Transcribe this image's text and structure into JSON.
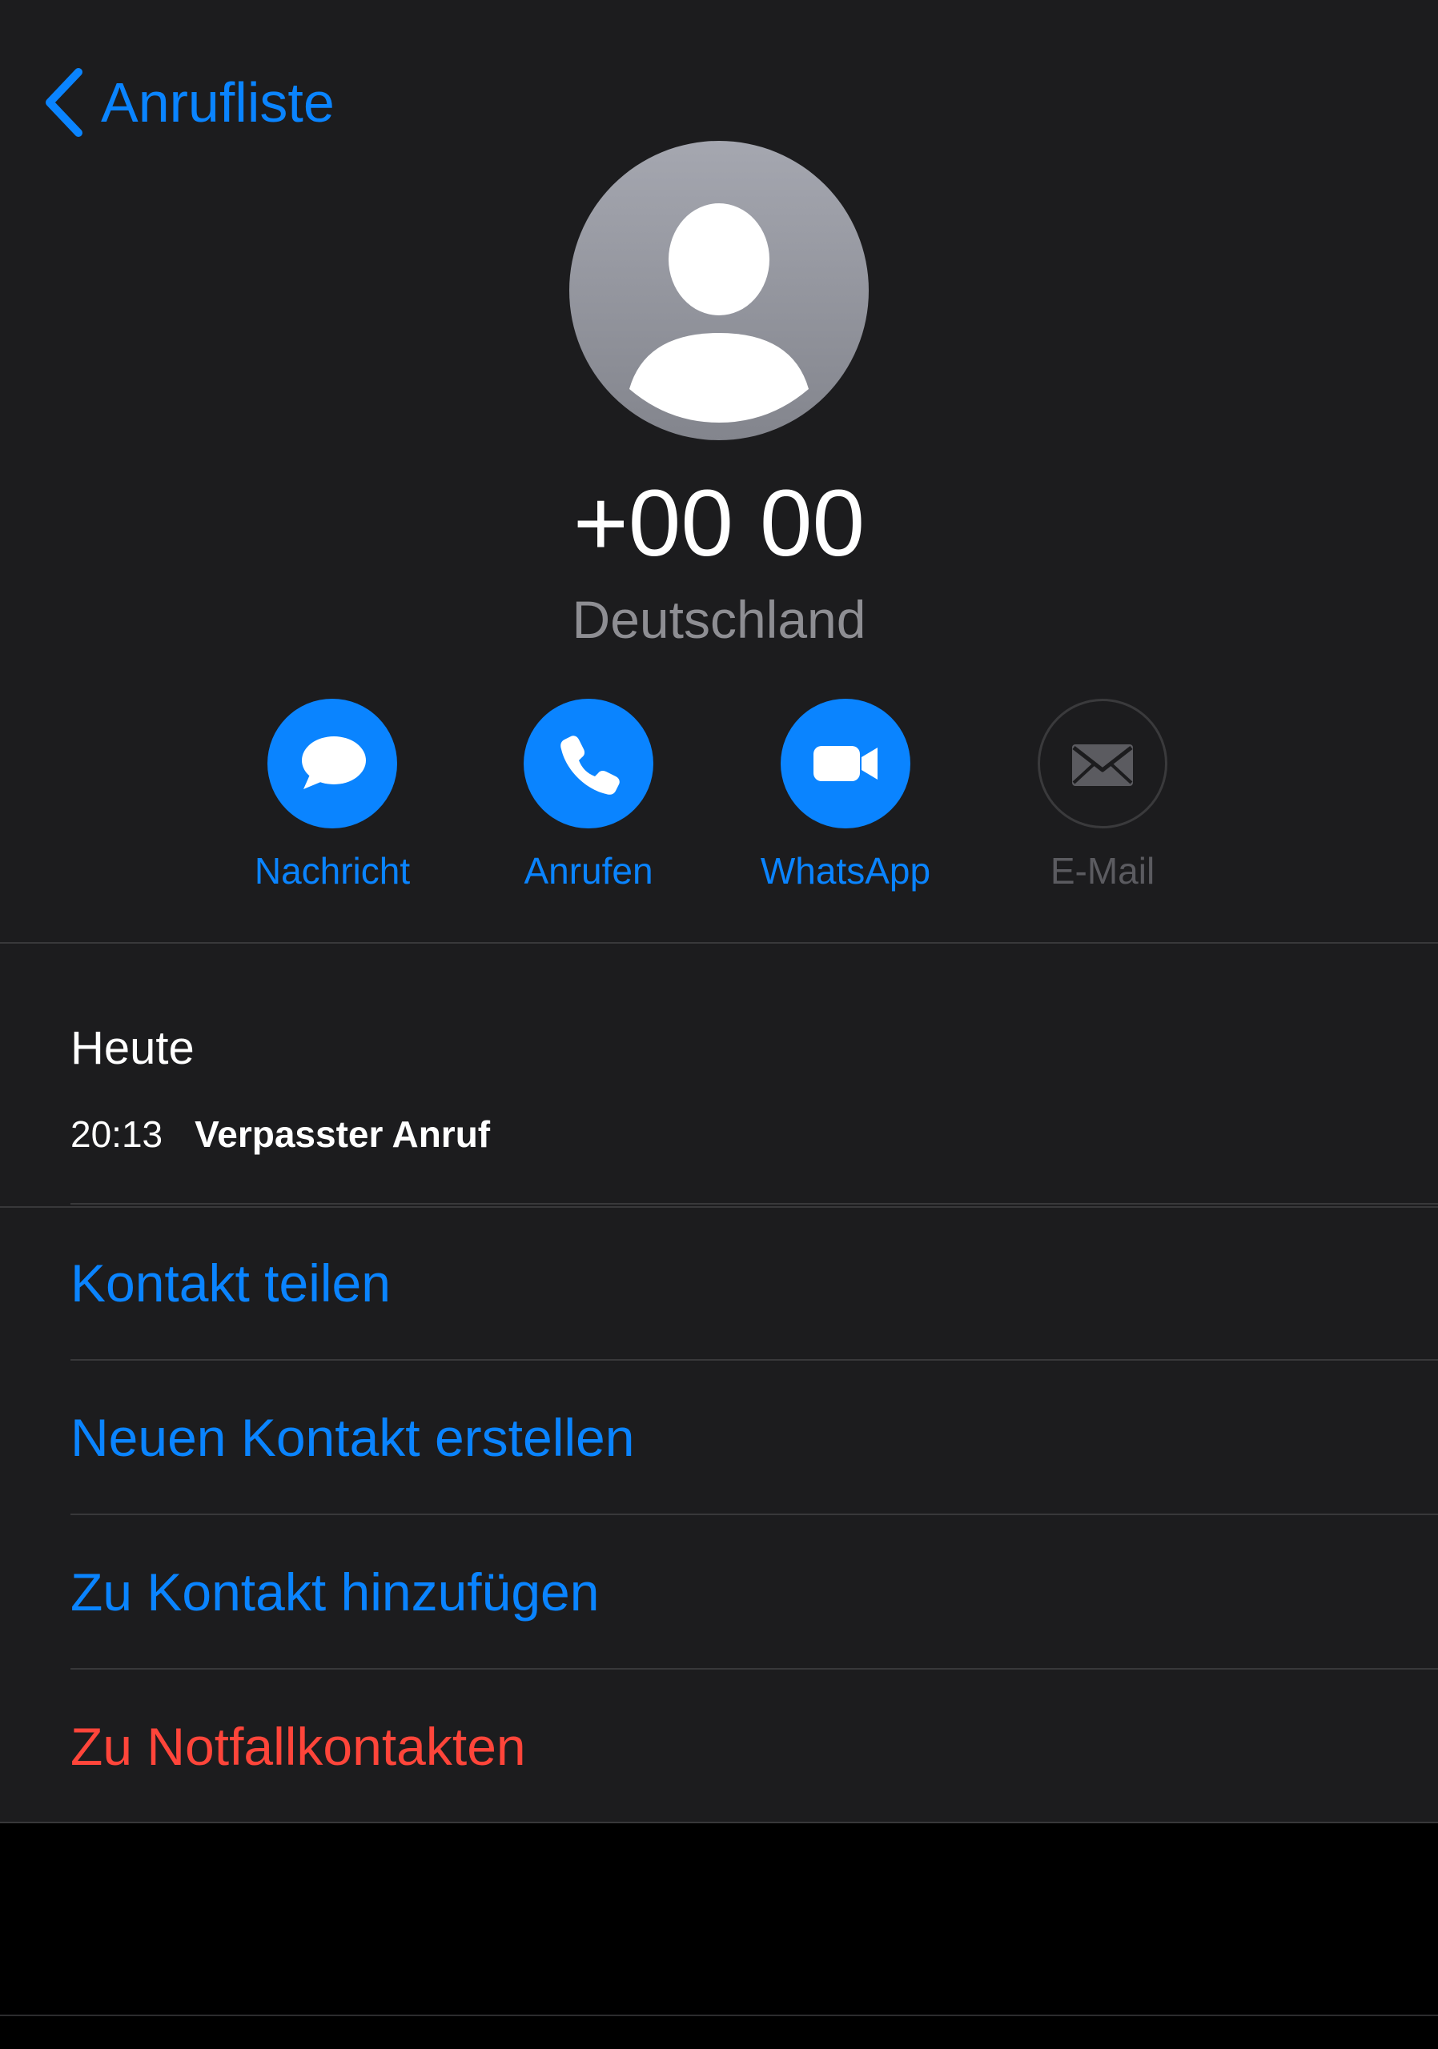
{
  "nav": {
    "back_label": "Anrufliste"
  },
  "contact": {
    "number": "+00 00",
    "country": "Deutschland"
  },
  "actions": [
    {
      "label": "Nachricht",
      "icon": "message-bubble-icon",
      "enabled": true
    },
    {
      "label": "Anrufen",
      "icon": "phone-icon",
      "enabled": true
    },
    {
      "label": "WhatsApp",
      "icon": "video-camera-icon",
      "enabled": true
    },
    {
      "label": "E-Mail",
      "icon": "envelope-icon",
      "enabled": false
    }
  ],
  "history": {
    "title": "Heute",
    "entries": [
      {
        "time": "20:13",
        "type": "Verpasster Anruf"
      }
    ]
  },
  "options": [
    {
      "label": "Kontakt teilen"
    },
    {
      "label": "Neuen Kontakt erstellen"
    },
    {
      "label": "Zu Kontakt hinzufügen"
    },
    {
      "label": "Zu Notfallkontakten"
    }
  ],
  "colors": {
    "accent": "#0a84ff",
    "danger": "#ff453a",
    "background": "#1c1c1e",
    "secondary_text": "#8e8e93"
  }
}
